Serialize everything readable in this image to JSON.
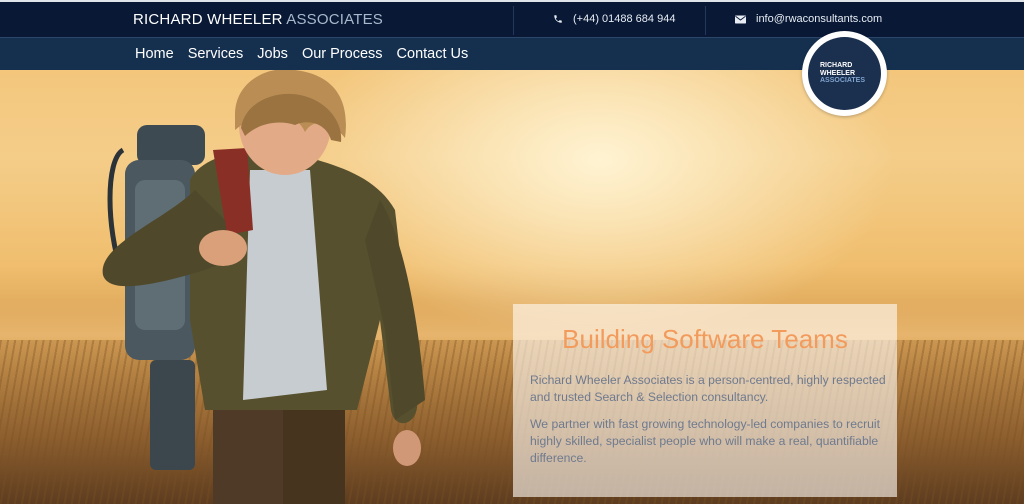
{
  "header": {
    "brand_primary": "RICHARD WHEELER",
    "brand_accent": "ASSOCIATES",
    "phone": "(+44) 01488 684 944",
    "email": "info@rwaconsultants.com",
    "phone_icon": "phone-icon",
    "email_icon": "envelope-icon"
  },
  "nav": {
    "items": [
      "Home",
      "Services",
      "Jobs",
      "Our Process",
      "Contact Us"
    ]
  },
  "logo": {
    "line1": "RICHARD",
    "line2": "WHEELER",
    "line3": "ASSOCIATES"
  },
  "hero": {
    "title": "Building Software Teams",
    "paragraph1": "Richard Wheeler Associates is a person-centred, highly respected and trusted Search & Selection consultancy.",
    "paragraph2": "We partner with fast growing technology-led companies to recruit highly skilled, specialist people who will make a real, quantifiable difference.",
    "title_color": "#f29b5c",
    "text_color": "#6e7a8e"
  },
  "colors": {
    "topbar": "#081835",
    "navbar": "#15304f",
    "logo_bg": "#1b2f4e"
  }
}
